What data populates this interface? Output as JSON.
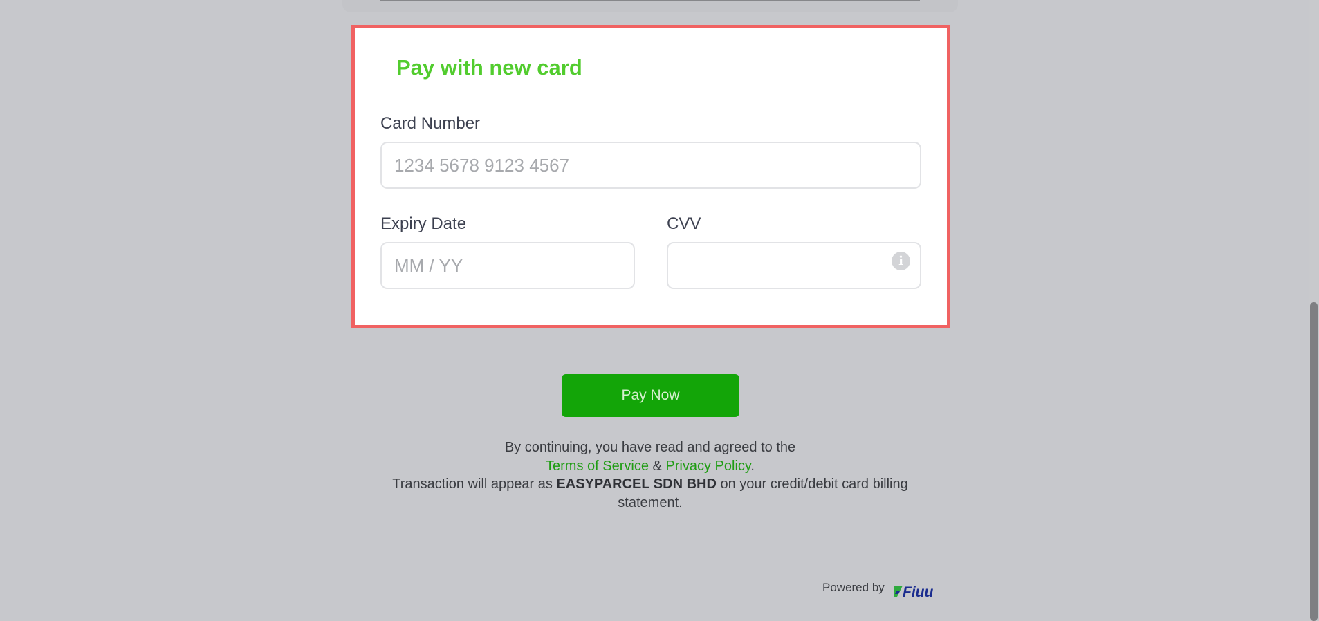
{
  "card_form": {
    "title": "Pay with new card",
    "card_number": {
      "label": "Card Number",
      "placeholder": "1234 5678 9123 4567",
      "value": ""
    },
    "expiry": {
      "label": "Expiry Date",
      "placeholder": "MM / YY",
      "value": ""
    },
    "cvv": {
      "label": "CVV",
      "placeholder": "",
      "value": "",
      "info_icon": "info-icon",
      "info_glyph": "i"
    }
  },
  "pay_button": {
    "label": "Pay Now"
  },
  "consent": {
    "line1": "By continuing, you have read and agreed to the",
    "terms_link": "Terms of Service",
    "and": "&",
    "privacy_link": "Privacy Policy",
    "period": ".",
    "statement_prefix": "Transaction will appear as",
    "merchant": "EASYPARCEL SDN BHD",
    "statement_suffix": "on your credit/debit card billing statement."
  },
  "footer": {
    "powered_by": "Powered by",
    "brand": "Fiuu"
  },
  "colors": {
    "accent_green": "#13a508",
    "title_green": "#52cc2e",
    "link_green": "#1f9c13",
    "highlight_border": "#f06262",
    "brand_navy": "#1b2d8f"
  }
}
